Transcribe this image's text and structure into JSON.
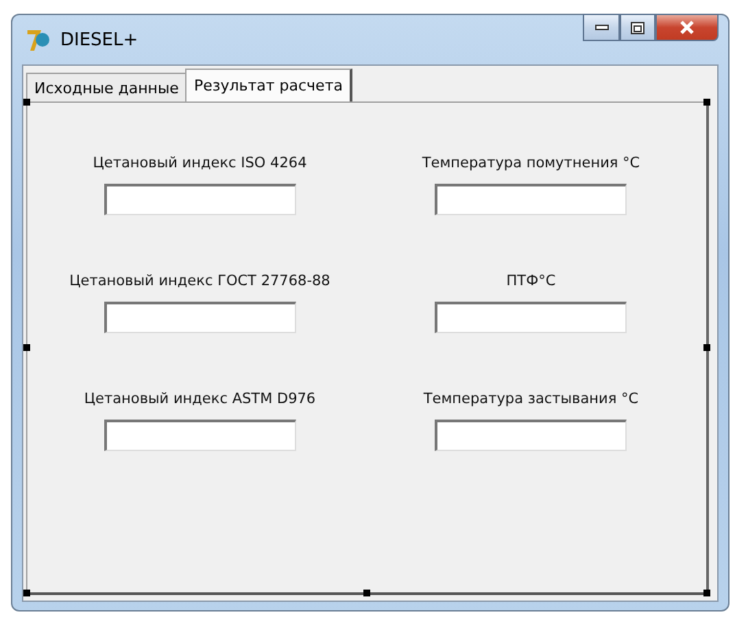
{
  "window": {
    "title": "DIESEL+"
  },
  "tabs": [
    {
      "label": "Исходные данные",
      "selected": false
    },
    {
      "label": "Результат расчета",
      "selected": true
    }
  ],
  "fields": [
    {
      "label": "Цетановый индекс ISO 4264"
    },
    {
      "label": "Температура помутнения °С"
    },
    {
      "label": "Цетановый индекс ГОСТ 27768-88"
    },
    {
      "label": "ПТФ°С"
    },
    {
      "label": "Цетановый индекс ASTM D976"
    },
    {
      "label": "Температура застывания °С"
    }
  ]
}
